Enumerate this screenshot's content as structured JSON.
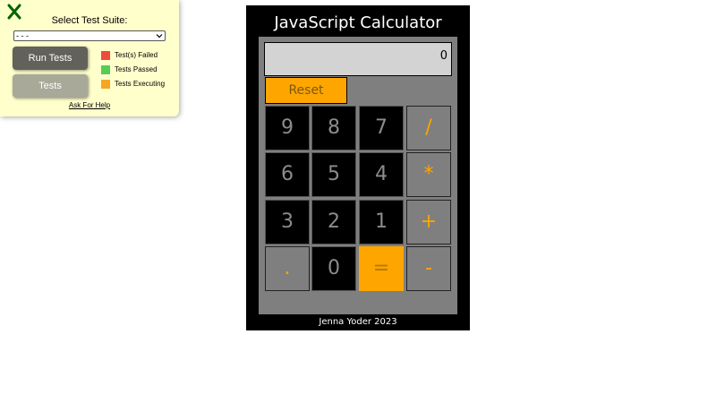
{
  "test_panel": {
    "title": "Select Test Suite:",
    "selected_suite": "- - -",
    "run_button": "Run Tests",
    "tests_button": "Tests",
    "legend": [
      {
        "label": "Test(s) Failed",
        "color": "#f04a3a"
      },
      {
        "label": "Tests Passed",
        "color": "#55cc55"
      },
      {
        "label": "Tests Executing",
        "color": "#f5a623"
      }
    ],
    "help_link": "Ask For Help",
    "close_icon": "close-x-icon",
    "close_color": "#006400"
  },
  "calculator": {
    "title": "JavaScript Calculator",
    "display": "0",
    "reset": "Reset",
    "keys": {
      "k9": "9",
      "k8": "8",
      "k7": "7",
      "div": "/",
      "k6": "6",
      "k5": "5",
      "k4": "4",
      "mul": "*",
      "k3": "3",
      "k2": "2",
      "k1": "1",
      "add": "+",
      "dot": ".",
      "k0": "0",
      "eq": "=",
      "sub": "-"
    },
    "footer": "Jenna Yoder 2023",
    "accent_color": "#ffa500"
  }
}
